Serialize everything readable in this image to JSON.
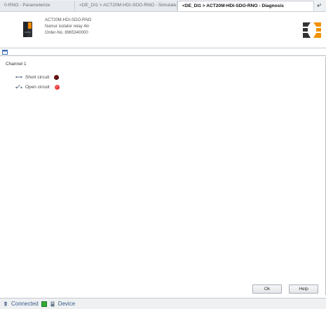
{
  "tabs": {
    "items": [
      {
        "label": "0-RNO - Parameterize"
      },
      {
        "label": "<DE_DI1 > ACT20M-HDI-SDO-RNO - Simulate"
      },
      {
        "label": "<DE_DI1 > ACT20M-HDI-SDO-RNO - Diagnosis",
        "active": true
      }
    ],
    "overflow": "»¹"
  },
  "device": {
    "name": "ACT20M-HDI-SDO-RNO",
    "vendor": "Namur isolator relay 4in",
    "order_no": "Order-No. 8965340000"
  },
  "diagnosis": {
    "group_title": "Channel 1",
    "rows": [
      {
        "label": "Short circuit",
        "led": "dark"
      },
      {
        "label": "Open circuit",
        "led": "red"
      }
    ]
  },
  "buttons": {
    "ok": "Ok",
    "help": "Help"
  },
  "status": {
    "connection": "Connected",
    "device": "Device"
  },
  "colors": {
    "led_dark": "#5a0000",
    "led_red": "#e01b1b",
    "brand_orange": "#f29100",
    "brand_dark": "#333333",
    "status_text": "#3a5a8a"
  }
}
